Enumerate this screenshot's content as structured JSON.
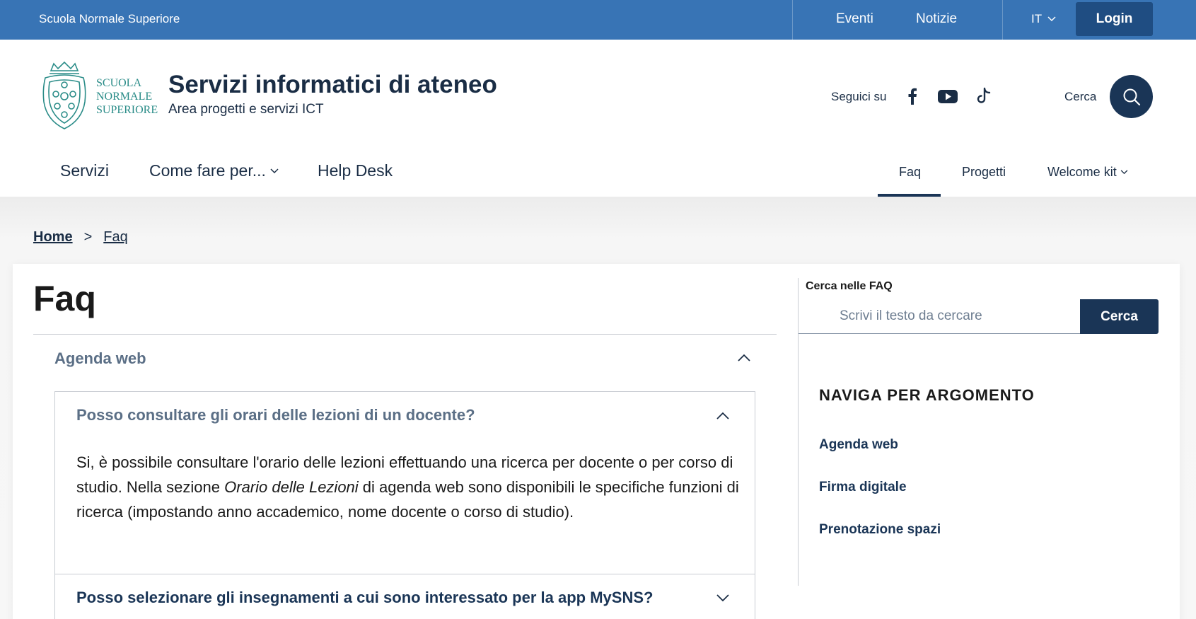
{
  "topbar": {
    "org_name": "Scuola Normale Superiore",
    "links": [
      "Eventi",
      "Notizie"
    ],
    "language": "IT",
    "login_label": "Login"
  },
  "header": {
    "logo_text": [
      "SCUOLA",
      "NORMALE",
      "SUPERIORE"
    ],
    "site_title": "Servizi informatici di ateneo",
    "site_subtitle": "Area progetti e servizi ICT",
    "follow_label": "Seguici su",
    "social_icons": [
      "facebook-icon",
      "youtube-icon",
      "tiktok-icon"
    ],
    "search_label": "Cerca"
  },
  "nav": {
    "main_items": [
      "Servizi",
      "Come fare per...",
      "Help Desk"
    ],
    "secondary_items": [
      "Faq",
      "Progetti",
      "Welcome kit"
    ],
    "active_item": "Faq"
  },
  "breadcrumb": {
    "home": "Home",
    "separator": ">",
    "current": "Faq"
  },
  "main": {
    "page_title": "Faq",
    "section_label": "Agenda web",
    "faqs": [
      {
        "question": "Posso consultare gli orari delle lezioni di un docente?",
        "answer_part1": "Si, è possibile consultare l'orario delle lezioni effettuando una ricerca per docente o per corso di studio. Nella sezione ",
        "answer_italic": "Orario delle Lezioni",
        "answer_part2": " di agenda web sono disponibili le specifiche funzioni di ricerca (impostando anno accademico, nome docente o corso di studio).",
        "expanded": true
      },
      {
        "question": "Posso selezionare gli insegnamenti a cui sono interessato per la app MySNS?",
        "expanded": false
      }
    ]
  },
  "sidebar": {
    "search_label": "Cerca nelle FAQ",
    "search_placeholder": "Scrivi il testo da cercare",
    "search_button": "Cerca",
    "topics_title": "NAVIGA PER ARGOMENTO",
    "topics": [
      "Agenda web",
      "Firma digitale",
      "Prenotazione spazi"
    ]
  },
  "colors": {
    "topbar": "#3874b5",
    "primary_dark": "#1a3556",
    "muted_text": "#5b6f86"
  }
}
